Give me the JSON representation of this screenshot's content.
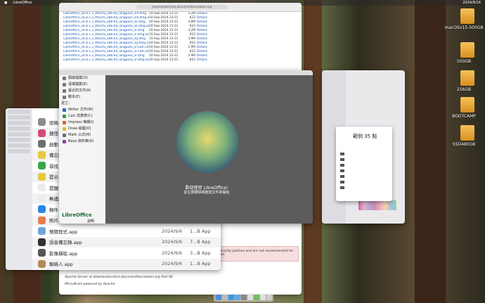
{
  "menubar": {
    "app": "LibreOffice",
    "clock": "2024/9/16"
  },
  "browser": {
    "url": "downloadarchive.documentfoundation.org",
    "files": [
      {
        "name": "LibreOffice_24.8.1.2_MacOS_x86-64_langpack_sid.dmg",
        "date": "10-Sep-2024 23:31",
        "size": "2.2M",
        "link": "Details"
      },
      {
        "name": "LibreOffice_24.8.1.2_MacOS_x86-64_langpack_sid.dmg.asc",
        "date": "10-Sep-2024 23:31",
        "size": "833",
        "link": "Details"
      },
      {
        "name": "LibreOffice_24.8.1.2_MacOS_x86-64_langpack_sk.dmg",
        "date": "10-Sep-2024 23:31",
        "size": "4.8M",
        "link": "Details"
      },
      {
        "name": "LibreOffice_24.8.1.2_MacOS_x86-64_langpack_sk.dmg.asc",
        "date": "10-Sep-2024 23:31",
        "size": "833",
        "link": "Details"
      },
      {
        "name": "LibreOffice_24.8.1.2_MacOS_x86-64_langpack_sl.dmg",
        "date": "10-Sep-2024 23:31",
        "size": "3.2M",
        "link": "Details"
      },
      {
        "name": "LibreOffice_24.8.1.2_MacOS_x86-64_langpack_sl.dmg.asc",
        "date": "10-Sep-2024 23:31",
        "size": "833",
        "link": "Details"
      },
      {
        "name": "LibreOffice_24.8.1.2_MacOS_x86-64_langpack_sq.dmg",
        "date": "10-Sep-2024 23:31",
        "size": "3.9M",
        "link": "Details"
      },
      {
        "name": "LibreOffice_24.8.1.2_MacOS_x86-64_langpack_sq.dmg.asc",
        "date": "10-Sep-2024 23:31",
        "size": "833",
        "link": "Details"
      },
      {
        "name": "LibreOffice_24.8.1.2_MacOS_x86-64_langpack_sr-Latn.dmg",
        "date": "10-Sep-2024 23:31",
        "size": "2.9M",
        "link": "Details"
      },
      {
        "name": "LibreOffice_24.8.1.2_MacOS_x86-64_langpack_sr-Latn.dmg.asc",
        "date": "10-Sep-2024 23:31",
        "size": "833",
        "link": "Details"
      },
      {
        "name": "LibreOffice_24.8.1.2_MacOS_x86-64_langpack_sr.dmg",
        "date": "10-Sep-2024 23:31",
        "size": "2.9M",
        "link": "Details"
      },
      {
        "name": "LibreOffice_24.8.1.2_MacOS_x86-64_langpack_sr.dmg.asc",
        "date": "10-Sep-2024 23:31",
        "size": "833",
        "link": "Details"
      }
    ],
    "warning": "security patches and are not recommended for use",
    "footer1": "Apache Server at downloadarchive.documentfoundation.org Port 80",
    "footer2": "MirrorBrain powered by Apache"
  },
  "libreoffice": {
    "sidebar": [
      {
        "label": "開啟檔案(O)",
        "color": "#777"
      },
      {
        "label": "遠端檔案(E)",
        "color": "#777"
      },
      {
        "label": "最近的文件(R)",
        "color": "#777"
      },
      {
        "label": "範本(E)",
        "color": "#777"
      }
    ],
    "create_header": "建立：",
    "create": [
      {
        "label": "Writer 文件(W)",
        "color": "#2b6cc4"
      },
      {
        "label": "Calc 試算表(C)",
        "color": "#2e9c48"
      },
      {
        "label": "Impress 簡報(I)",
        "color": "#d9602b"
      },
      {
        "label": "Draw 繪圖(D)",
        "color": "#e2b52d"
      },
      {
        "label": "Math 公式(M)",
        "color": "#6c6c6c"
      },
      {
        "label": "Base 資料庫(A)",
        "color": "#8a3fae"
      }
    ],
    "logo": "LibreOffice",
    "help": "說明",
    "welcome1": "歡迎使用 LibreOffice!",
    "welcome2": "從左側選擇或拖放文件來開始"
  },
  "finder": {
    "apps": [
      {
        "name": "密碼.app",
        "date": "",
        "kind": "",
        "color": "#8c8c8c"
      },
      {
        "name": "捷徑.app",
        "date": "",
        "kind": "",
        "color": "#d64b7a"
      },
      {
        "name": "啟動台.app",
        "date": "",
        "kind": "",
        "color": "#6f6f6f"
      },
      {
        "name": "備忘錄.app",
        "date": "",
        "kind": "",
        "color": "#e8c93e"
      },
      {
        "name": "尋找.app",
        "date": "",
        "kind": "",
        "color": "#37a84a"
      },
      {
        "name": "提示.app",
        "date": "",
        "kind": "",
        "color": "#e8c93e"
      },
      {
        "name": "提醒事項.app",
        "date": "",
        "kind": "",
        "color": "#ececec"
      },
      {
        "name": "無邊記.app",
        "date": "",
        "kind": "",
        "color": "#ececec"
      },
      {
        "name": "郵件.app",
        "date": "",
        "kind": "",
        "color": "#2d86e3"
      },
      {
        "name": "照片.app",
        "date": "",
        "kind": "",
        "color": "#e77a4c"
      },
      {
        "name": "預覽程式.app",
        "date": "2024/9/6",
        "kind": "1...B App",
        "color": "#6aa6d8"
      },
      {
        "name": "語音備忘錄.app",
        "date": "2024/9/6",
        "kind": "7...B App",
        "color": "#303030"
      },
      {
        "name": "影像擷取.app",
        "date": "2024/9/6",
        "kind": "3...B App",
        "color": "#555"
      },
      {
        "name": "聯絡人.app",
        "date": "2024/9/6",
        "kind": "1...B App",
        "color": "#b68a5a"
      }
    ]
  },
  "dialog": {
    "title": "範例 35 點"
  },
  "drives": [
    {
      "label": "macOSv15-500GB"
    },
    {
      "label": "500GB"
    },
    {
      "label": "256GB"
    },
    {
      "label": "BOOTCAMP"
    },
    {
      "label": "SSD480GB"
    }
  ]
}
